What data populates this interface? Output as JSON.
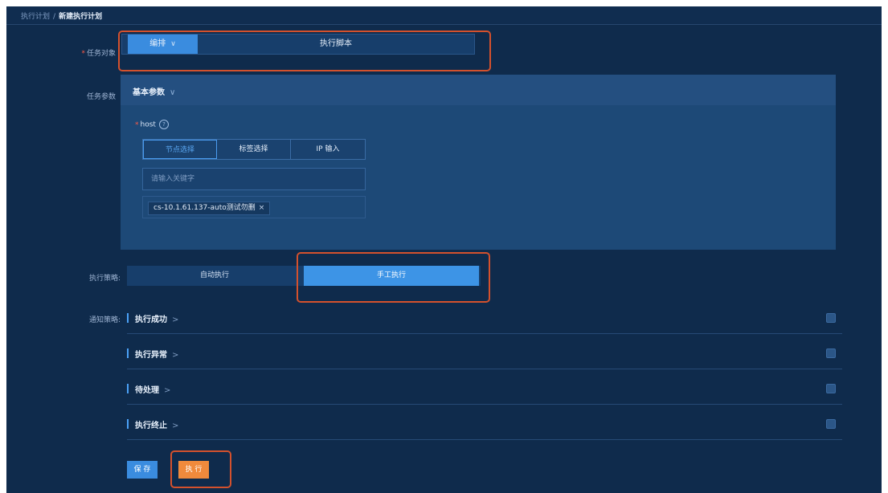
{
  "breadcrumb": {
    "parent": "执行计划",
    "separator": "/",
    "current": "新建执行计划"
  },
  "task_object": {
    "label": "任务对象",
    "required_mark": "*",
    "options": {
      "arrange": "编排",
      "arrange_chevron": "∨",
      "script": "执行脚本"
    }
  },
  "task_params": {
    "label": "任务参数",
    "section_title": "基本参数",
    "section_chevron": "∨",
    "host_label": "host",
    "required_mark": "*",
    "help_glyph": "?",
    "tabs": [
      "节点选择",
      "标签选择",
      "IP 输入"
    ],
    "search_placeholder": "请输入关键字",
    "tags": [
      {
        "text": "cs-10.1.61.137-auto测试勿删",
        "close": "×"
      }
    ]
  },
  "strategy": {
    "label": "执行策略:",
    "options": [
      "自动执行",
      "手工执行"
    ],
    "selected": "手工执行"
  },
  "notifications": {
    "label": "通知策略:",
    "chevron": ">",
    "items": [
      "执行成功",
      "执行异常",
      "待处理",
      "执行终止"
    ]
  },
  "actions": {
    "save": "保 存",
    "run": "执 行"
  },
  "colors": {
    "accent": "#3a8cdf",
    "run": "#f08a3c",
    "highlight": "#d4512d",
    "background": "#0f2b4c"
  }
}
